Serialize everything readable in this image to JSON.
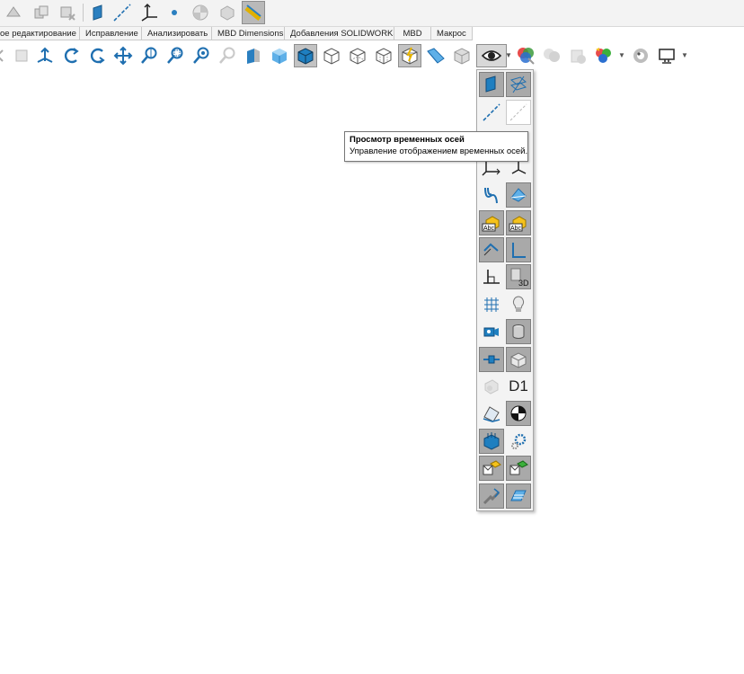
{
  "tabs": [
    "ое редактирование",
    "Исправление",
    "Анализировать",
    "MBD Dimensions",
    "Добавления SOLIDWORKS",
    "MBD",
    "Макрос"
  ],
  "tooltip": {
    "title": "Просмотр временных осей",
    "description": "Управление отображением временных осей."
  },
  "flyout": {
    "d1_label": "D1"
  },
  "colors": {
    "toolbar_bg": "#f3f3f3",
    "pressed_bg": "#a9a9a9",
    "icon_blue": "#1f7fc0",
    "icon_yellow": "#f5c21b"
  },
  "icons": {
    "top_toolbar": [
      "ref-geometry-icon",
      "assembly-icon",
      "delete-component-icon",
      "plane-icon",
      "axis-icon",
      "coordinate-system-icon",
      "point-icon",
      "center-of-mass-icon",
      "mate-reference-icon",
      "measure-ruler-icon"
    ],
    "view_toolbar": [
      "previous-view-icon",
      "selection-icon",
      "normal-to-icon",
      "rotate-icon",
      "roll-icon",
      "pan-icon",
      "zoom-icon",
      "zoom-to-area-icon",
      "zoom-selection-icon",
      "zoom-fit-icon",
      "section-view-icon",
      "view-orientation-icon",
      "shaded-icon",
      "wireframe-icon",
      "hidden-lines-visible-icon",
      "hidden-lines-removed-icon",
      "draft-quality-icon",
      "shaded-with-edges-icon",
      "perspective-icon",
      "hide-show-items-icon",
      "edit-appearance-icon",
      "apply-scene-icon",
      "view-settings-icon",
      "realview-icon",
      "display-monitor-icon"
    ]
  }
}
